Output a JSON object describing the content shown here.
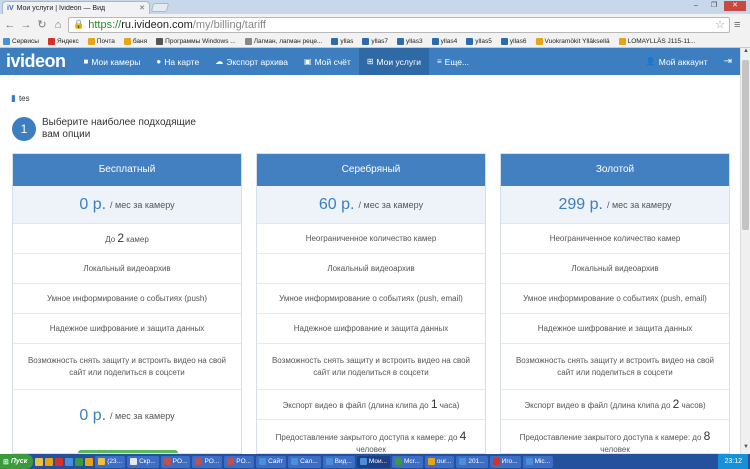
{
  "browser": {
    "tab_title": "Мои услуги | Ivideon — Вид",
    "url_scheme": "https://",
    "url_host": "ru.ivideon.com",
    "url_path": "/my/billing/tariff"
  },
  "bookmarks": [
    {
      "label": "Сервисы",
      "color": "#4a90d9"
    },
    {
      "label": "Яндекс",
      "color": "#d93025"
    },
    {
      "label": "Почта",
      "color": "#e8a317"
    },
    {
      "label": "баня",
      "color": "#e8a317"
    },
    {
      "label": "Программы Windows ...",
      "color": "#555555"
    },
    {
      "label": "Лагман, лагман реце...",
      "color": "#888888"
    },
    {
      "label": "yllas",
      "color": "#2b6cb0"
    },
    {
      "label": "yllas7",
      "color": "#2b6cb0"
    },
    {
      "label": "yllas3",
      "color": "#2b6cb0"
    },
    {
      "label": "yllas4",
      "color": "#2b6cb0"
    },
    {
      "label": "yllas5",
      "color": "#2b6cb0"
    },
    {
      "label": "yllas6",
      "color": "#2b6cb0"
    },
    {
      "label": "Vuokramökit Ylläksellä",
      "color": "#e8a317"
    },
    {
      "label": "LOMAYLLÄS J115-11...",
      "color": "#e8a317"
    }
  ],
  "nav": {
    "logo": "ivideon",
    "items": [
      {
        "label": "Мои камеры",
        "icon": "camera-icon"
      },
      {
        "label": "На карте",
        "icon": "map-pin-icon"
      },
      {
        "label": "Экспорт архива",
        "icon": "cloud-icon"
      },
      {
        "label": "Мой счёт",
        "icon": "wallet-icon"
      },
      {
        "label": "Мои услуги",
        "icon": "cart-icon"
      },
      {
        "label": "Еще...",
        "icon": "menu-icon"
      }
    ],
    "account": "Мой аккаунт"
  },
  "camera_name": "tes",
  "step": {
    "number": "1",
    "text": "Выберите наиболее подходящие вам опции"
  },
  "plans": [
    {
      "name": "Бесплатный",
      "price": "0 р.",
      "unit": "/ мес за камеру",
      "cam_prefix": "До ",
      "cam_count": "2",
      "cam_suffix": " камер",
      "f_archive": "Локальный видеоархив",
      "f_notify": "Умное информирование о событиях (push)",
      "f_encrypt": "Надежное шифрование и защита данных",
      "f_share": "Возможность снять защиту и встроить видео на свой сайт или поделиться в соцсети",
      "price2": "0 р.",
      "unit2": "/ мес за камеру"
    },
    {
      "name": "Серебряный",
      "price": "60 р.",
      "unit": "/ мес за камеру",
      "f_cams": "Неограниченное количество камер",
      "f_archive": "Локальный видеоархив",
      "f_notify": "Умное информирование о событиях (push, email)",
      "f_encrypt": "Надежное шифрование и защита данных",
      "f_share": "Возможность снять защиту и встроить видео на свой сайт или поделиться в соцсети",
      "export_prefix": "Экспорт видео в файл (длина клипа до ",
      "export_num": "1",
      "export_suffix": " часа)",
      "access_prefix": "Предоставление закрытого доступа к камере: до ",
      "access_num": "4",
      "access_suffix": " человек"
    },
    {
      "name": "Золотой",
      "price": "299 р.",
      "unit": "/ мес за камеру",
      "f_cams": "Неограниченное количество камер",
      "f_archive": "Локальный видеоархив",
      "f_notify": "Умное информирование о событиях (push, email)",
      "f_encrypt": "Надежное шифрование и защита данных",
      "f_share": "Возможность снять защиту и встроить видео на свой сайт или поделиться в соцсети",
      "export_prefix": "Экспорт видео в файл (длина клипа до ",
      "export_num": "2",
      "export_suffix": " часов)",
      "access_prefix": "Предоставление закрытого доступа к камере: до ",
      "access_num": "8",
      "access_suffix": " человек"
    }
  ],
  "taskbar": {
    "start": "Пуск",
    "items": [
      "(23...",
      "Скр...",
      "PO...",
      "PO...",
      "PO...",
      "Сайт",
      "Сал...",
      "Вид...",
      "Мои...",
      "Mcr...",
      "our...",
      "201...",
      "Иго...",
      "Mic..."
    ],
    "active_index": 8,
    "clock": "23:12"
  }
}
